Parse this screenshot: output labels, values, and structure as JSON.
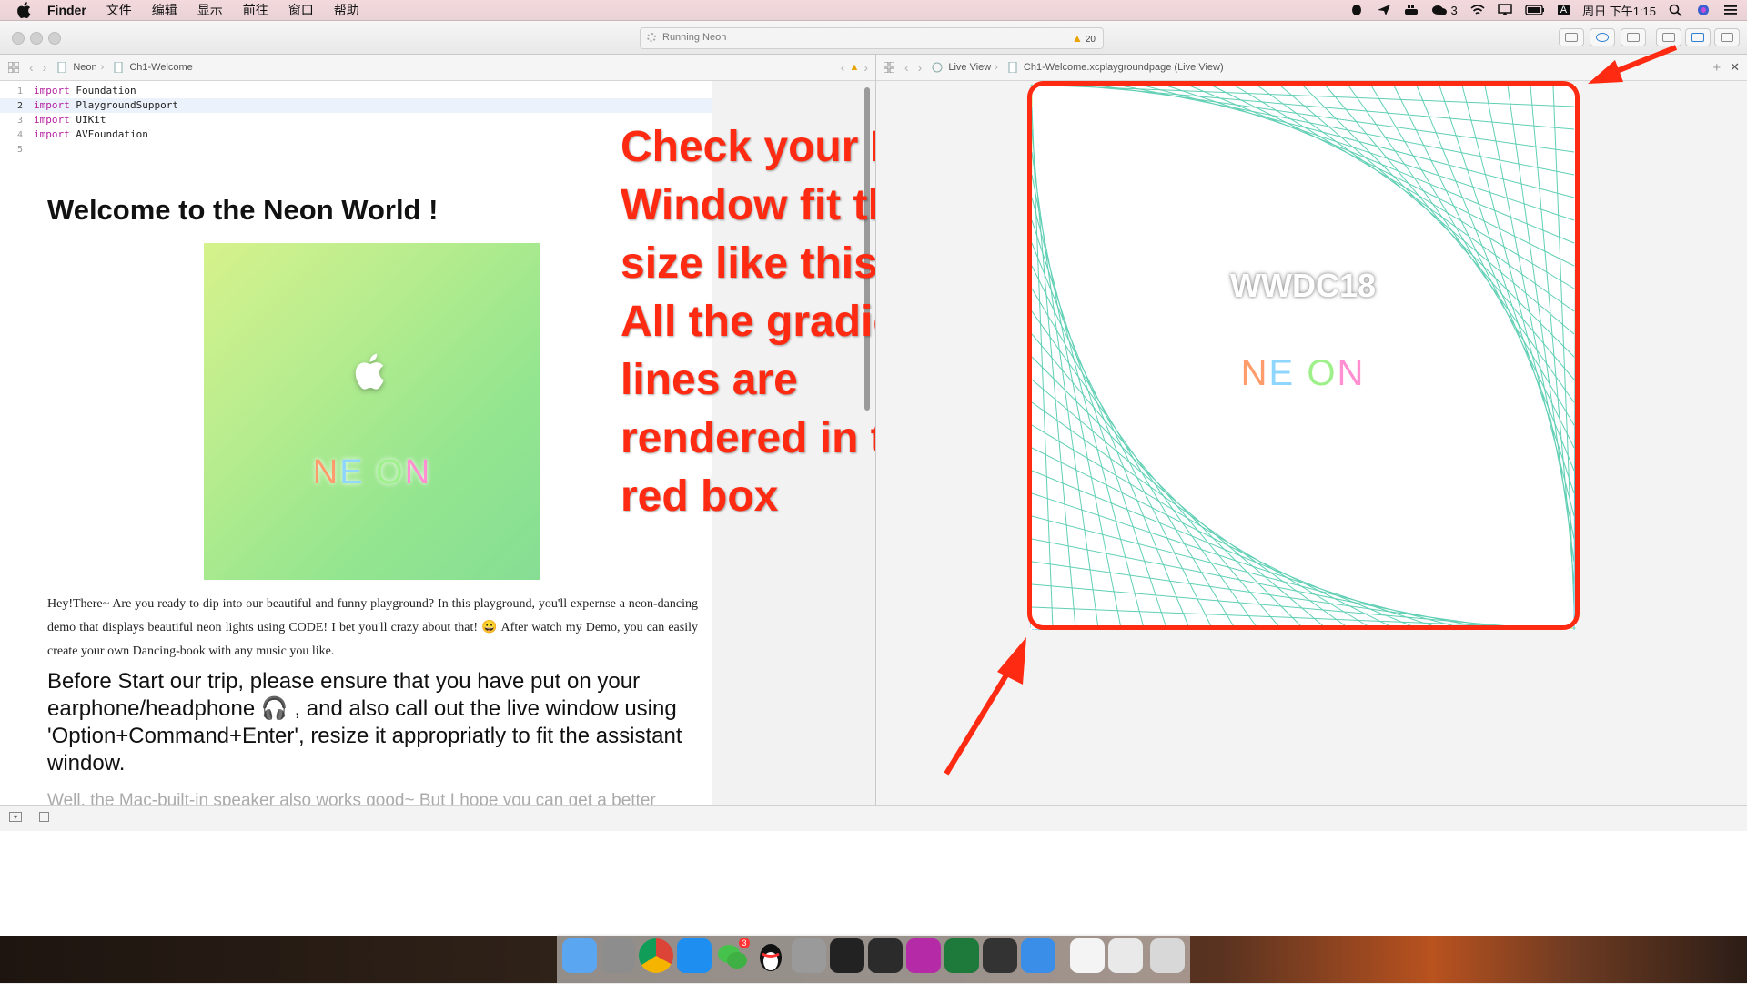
{
  "menubar": {
    "app": "Finder",
    "menus": [
      "文件",
      "编辑",
      "显示",
      "前往",
      "窗口",
      "帮助"
    ],
    "wechat_count": "3",
    "input_method": "A",
    "clock": "周日 下午1:15"
  },
  "toolbar": {
    "activity": "Running Neon",
    "warning_count": "20"
  },
  "editor_jumpbar": {
    "crumbs": [
      "Neon",
      "Ch1-Welcome"
    ]
  },
  "live_jumpbar": {
    "crumbs": [
      "Live View",
      "Ch1-Welcome.xcplaygroundpage (Live View)"
    ]
  },
  "code_lines": [
    {
      "num": "1",
      "kw": "import",
      "rest": " Foundation"
    },
    {
      "num": "2",
      "kw": "import",
      "rest": " PlaygroundSupport"
    },
    {
      "num": "3",
      "kw": "import",
      "rest": " UIKit"
    },
    {
      "num": "4",
      "kw": "import",
      "rest": " AVFoundation"
    },
    {
      "num": "5",
      "kw": "",
      "rest": ""
    }
  ],
  "doc": {
    "title": "Welcome to the Neon World !",
    "hero_neon": [
      "N",
      "E",
      "O",
      "N"
    ],
    "paragraph": "Hey!There~ Are you ready to dip into our beautiful and funny playground? In this playground, you'll expernse a neon-dancing demo that displays beautiful neon lights using CODE! I bet you'll crazy about that! 😀 After watch my Demo, you can easily create your own Dancing-book with any music you like.",
    "heading2": "Before Start our trip, please ensure that you have put on your earphone/headphone 🎧 , and also call out the live window using 'Option+Command+Enter', resize it appropriatly to fit the assistant window.",
    "more": "Well, the Mac-built-in speaker also works good~ But I hope you can get a better"
  },
  "annotation": {
    "lines": [
      "Check your Live",
      "Window fit the",
      "size like this.",
      "All the gradient",
      "lines are",
      "rendered in the",
      "red box"
    ],
    "color": "#ff2a12"
  },
  "live": {
    "wwdc": "WWDC18",
    "neon": [
      "N",
      "E",
      "O",
      "N"
    ]
  },
  "dock": {
    "apps": [
      "finder-icon",
      "launchpad-icon",
      "chrome-icon",
      "app-store-icon",
      "wechat-icon",
      "qq-icon",
      "system-preferences-icon",
      "terminal-icon",
      "activity-monitor-icon",
      "phpstorm-icon",
      "excel-icon",
      "script-editor-icon",
      "xcode-icon",
      "documents-icon",
      "downloads-icon",
      "trash-icon"
    ],
    "wechat_badge": "3"
  }
}
